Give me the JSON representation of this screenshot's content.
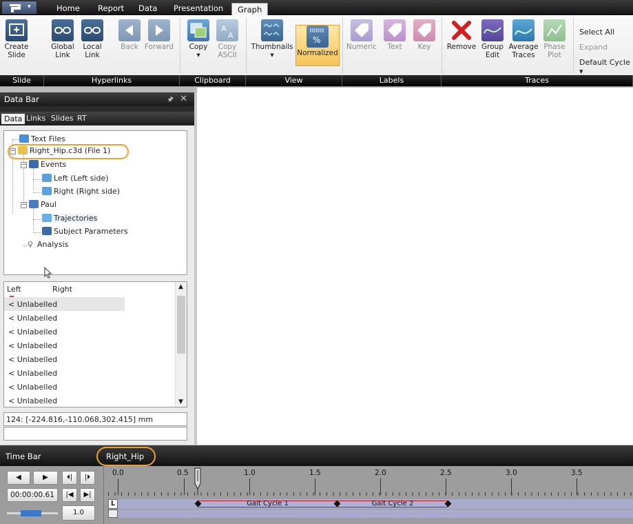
{
  "menubar": {
    "tabs": [
      "Home",
      "Report",
      "Data",
      "Presentation",
      "Graph"
    ],
    "active_tab": "Graph"
  },
  "ribbon": {
    "groups": {
      "slide": "Slide",
      "hyperlinks": "Hyperlinks",
      "clipboard": "Clipboard",
      "view": "View",
      "labels": "Labels",
      "traces": "Traces"
    },
    "buttons": {
      "create_slide": "Create\nSlide",
      "global_link": "Global\nLink",
      "local_link": "Local\nLink",
      "back": "Back",
      "forward": "Forward",
      "copy": "Copy",
      "copy_ascii": "Copy\nASCII",
      "thumbnails": "Thumbnails",
      "normalized": "Normalized",
      "numeric": "Numeric",
      "text": "Text",
      "key": "Key",
      "remove": "Remove",
      "group_edit": "Group\nEdit",
      "average_traces": "Average\nTraces",
      "phase_plot": "Phase\nPlot"
    },
    "commands": {
      "select_all": "Select All",
      "expand": "Expand",
      "default_cycle": "Default Cycle"
    }
  },
  "databar": {
    "title": "Data Bar",
    "subtabs": [
      "Data",
      "Links",
      "Slides",
      "RT"
    ],
    "tree": {
      "text_files": "Text Files",
      "file": "Right_Hip.c3d (File 1)",
      "events": "Events",
      "left": "Left (Left side)",
      "right": "Right (Right side)",
      "subject": "Paul",
      "trajectories": "Trajectories",
      "subject_params": "Subject Parameters",
      "analysis": "Analysis"
    },
    "list": {
      "col_left": "Left",
      "col_right": "Right",
      "rows": [
        "< Unlabelled",
        "< Unlabelled",
        "< Unlabelled",
        "< Unlabelled",
        "< Unlabelled",
        "< Unlabelled",
        "< Unlabelled",
        "< Unlabelled"
      ]
    },
    "status": "124: [-224.816,-110.068,302.415] mm",
    "status2": ""
  },
  "timebar": {
    "title": "Time Bar",
    "tab": "Right_Hip",
    "time": "00:00:00.61",
    "speed": "1.0",
    "ticks": [
      "0.0",
      "0.5",
      "1.0",
      "1.5",
      "2.0",
      "2.5",
      "3.0",
      "3.5"
    ],
    "row_label": "L",
    "cycles": [
      "Gait Cycle 1",
      "Gait Cycle 2"
    ]
  },
  "colors": {
    "accent_orange": "#f0a030",
    "selected_button": "#f7c45a",
    "cycle_border": "#c02020",
    "track": "#aaaacf"
  }
}
